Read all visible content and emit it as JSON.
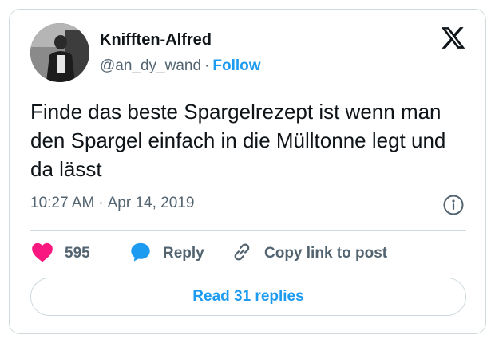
{
  "author": {
    "name": "Knifften-Alfred",
    "handle": "@an_dy_wand",
    "separator": "·",
    "follow_label": "Follow"
  },
  "tweet": {
    "text": "Finde das beste Spargelrezept ist wenn man den Spargel einfach in die Mülltonne legt und da lässt",
    "time": "10:27 AM",
    "separator": "·",
    "date": "Apr 14, 2019"
  },
  "actions": {
    "like_count": "595",
    "reply_label": "Reply",
    "copy_label": "Copy link to post"
  },
  "read_replies_label": "Read 31 replies",
  "icons": {
    "brand": "x-logo-icon",
    "info": "info-icon",
    "like": "heart-icon",
    "reply": "speech-bubble-icon",
    "copy": "link-icon"
  },
  "colors": {
    "accent": "#1d9bf0",
    "like": "#f91880",
    "text": "#0f1419",
    "muted": "#536471",
    "border": "#cfd9de"
  }
}
